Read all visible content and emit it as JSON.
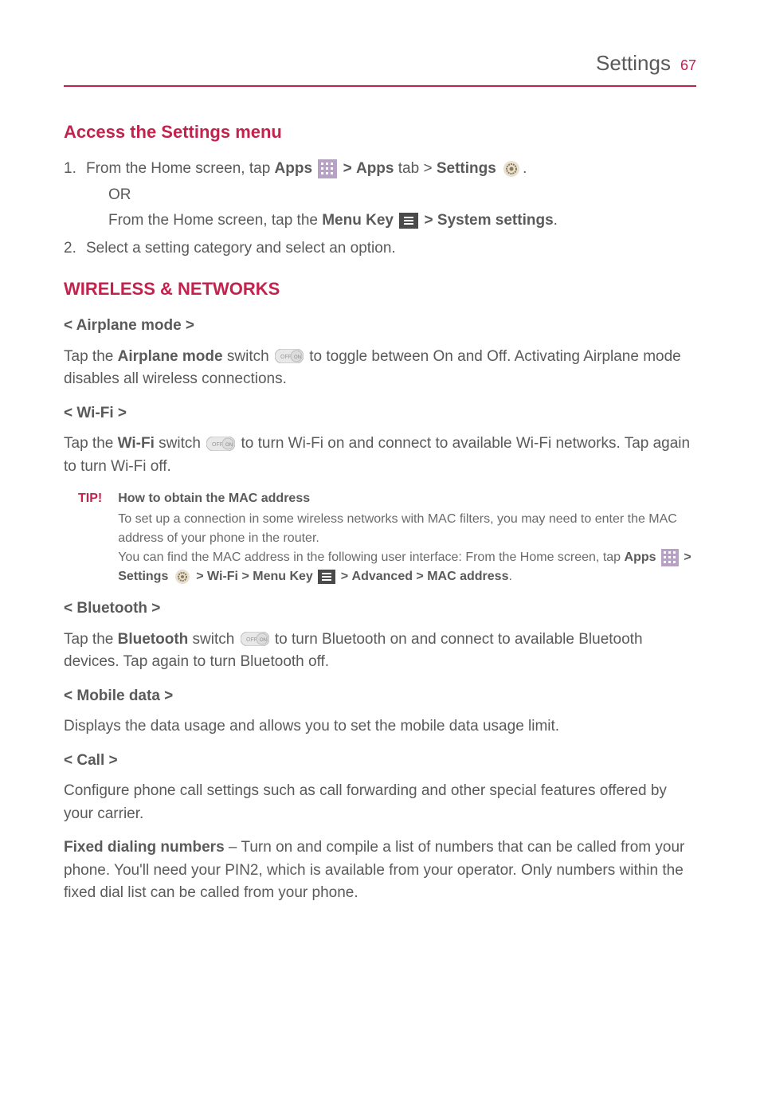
{
  "header": {
    "title": "Settings",
    "page": "67"
  },
  "sec1": {
    "title": "Access the Settings menu",
    "step1a": "From the Home screen, tap ",
    "apps_b": "Apps",
    "gt1": " > ",
    "apps_tab_b": "Apps",
    "tab_txt": " tab > ",
    "settings_b": "Settings",
    "dot": ".",
    "or": "OR",
    "step1b_pre": "From the Home screen, tap the ",
    "menukey_b": "Menu Key",
    "gt2": " > ",
    "systemsettings_b": "System settings",
    "step2": "Select a setting category and select an option."
  },
  "sec2": {
    "title": "WIRELESS & NETWORKS"
  },
  "airplane": {
    "heading": "< Airplane mode >",
    "p_pre": "Tap the ",
    "am_b": "Airplane mode",
    "p_mid": " switch ",
    "p_post": " to toggle between On and Off. Activating Airplane mode disables all wireless connections."
  },
  "wifi": {
    "heading": "< Wi-Fi >",
    "p_pre": "Tap the ",
    "wifi_b": "Wi-Fi",
    "p_mid": " switch ",
    "p_post": " to turn Wi-Fi on and connect to available Wi-Fi networks. Tap again to turn Wi-Fi off."
  },
  "tip": {
    "label": "TIP!",
    "title": "How to obtain the MAC address",
    "line1": "To set up a connection in some wireless networks with MAC filters, you may need to enter the MAC address of your phone in the router.",
    "line2": "You can find the MAC address in the following user interface: From the Home screen, tap ",
    "apps_b": "Apps",
    "gt1": " > ",
    "settings_b": "Settings",
    "gt2": " > ",
    "wifi_b": "Wi-Fi",
    "gt3": " > ",
    "menukey_b": "Menu Key",
    "gt4": " > ",
    "advanced_b": "Advanced",
    "gt5": " > ",
    "mac_b": "MAC address",
    "end": "."
  },
  "bt": {
    "heading": "< Bluetooth >",
    "p_pre": "Tap the ",
    "bt_b": "Bluetooth",
    "p_mid": " switch ",
    "p_post": " to turn Bluetooth on and connect to available Bluetooth devices. Tap again to turn Bluetooth off."
  },
  "mobile": {
    "heading": "< Mobile data >",
    "p": "Displays the data usage and allows you to set the mobile data usage limit."
  },
  "call": {
    "heading": "< Call >",
    "p": "Configure phone call settings such as call forwarding and other special features offered by your carrier.",
    "fdn_b": "Fixed dialing numbers",
    "fdn_txt": " – Turn on and compile a list of numbers that can be called from your phone. You'll need your PIN2, which is available from your operator. Only numbers within the fixed dial list can be called from your phone."
  }
}
